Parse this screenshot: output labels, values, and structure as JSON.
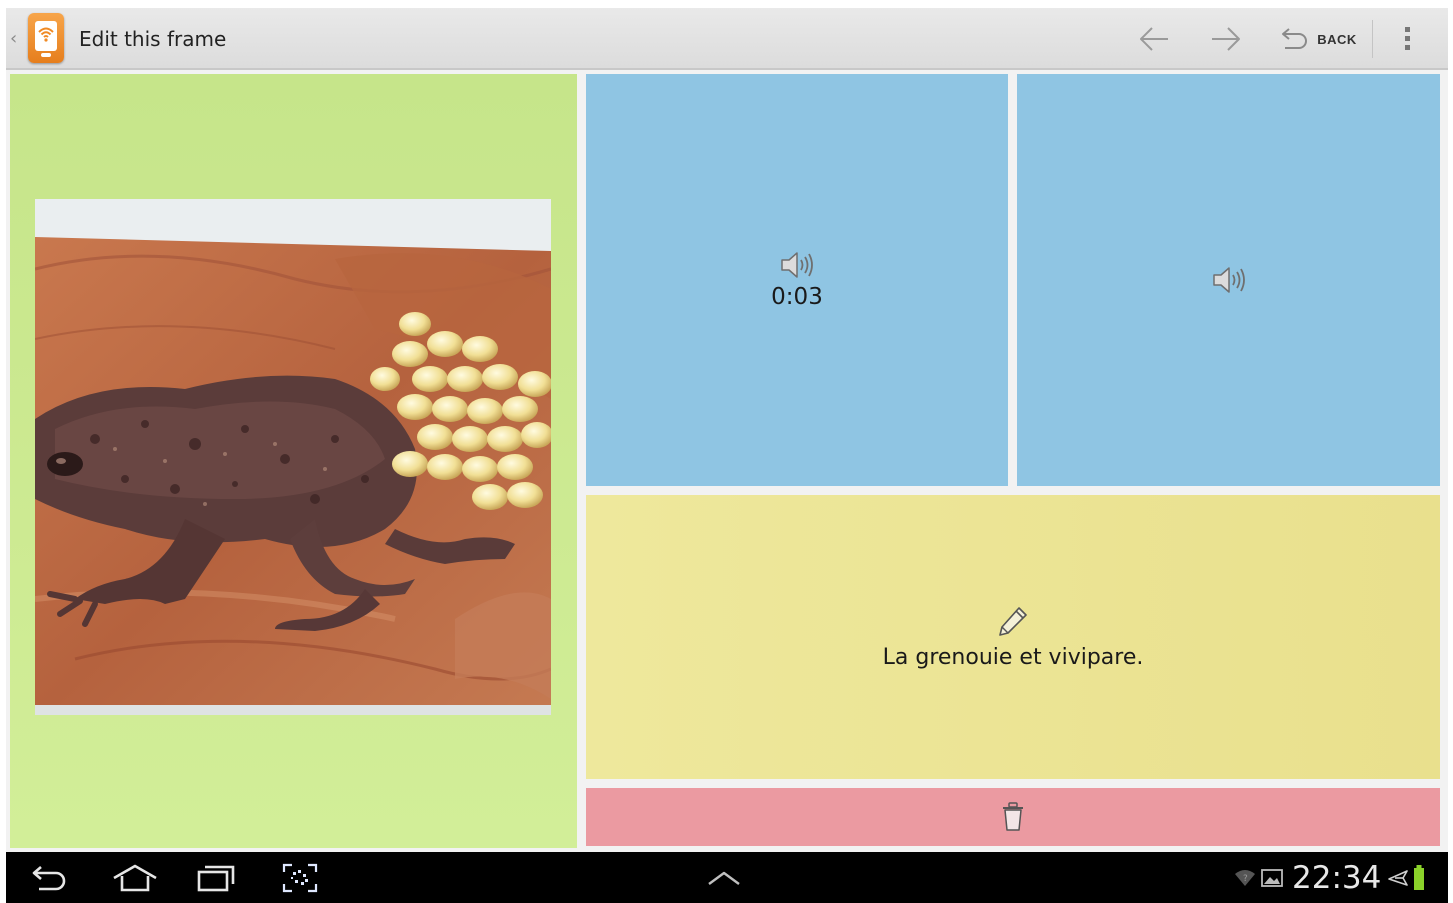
{
  "action_bar": {
    "title": "Edit this frame",
    "back_label": "BACK",
    "icons": {
      "up": "chevron-left-icon",
      "app": "wifi-phone-app-icon",
      "previous": "arrow-left-icon",
      "next": "arrow-right-icon",
      "back": "undo-arrow-icon",
      "overflow": "overflow-menu-icon"
    }
  },
  "frame": {
    "image_panel": {
      "color": "#c8e68b",
      "image": "frog-with-eggs-photo"
    },
    "audio_panels": [
      {
        "duration": "0:03",
        "icon": "speaker-icon",
        "color": "#8fc5e3"
      },
      {
        "duration": "",
        "icon": "speaker-icon",
        "color": "#8fc5e3"
      }
    ],
    "text_panel": {
      "icon": "pencil-icon",
      "caption": "La grenouie et vivipare.",
      "color": "#ece596"
    },
    "delete_panel": {
      "icon": "trash-icon",
      "color": "#eb9aa1"
    }
  },
  "system_bar": {
    "clock": "22:34",
    "icons": [
      "back-icon",
      "home-icon",
      "recents-icon",
      "screenshot-icon",
      "chevron-up-icon",
      "wifi-icon",
      "gallery-notification-icon",
      "airplane-icon",
      "battery-icon"
    ],
    "battery_color": "#8bd22a"
  }
}
